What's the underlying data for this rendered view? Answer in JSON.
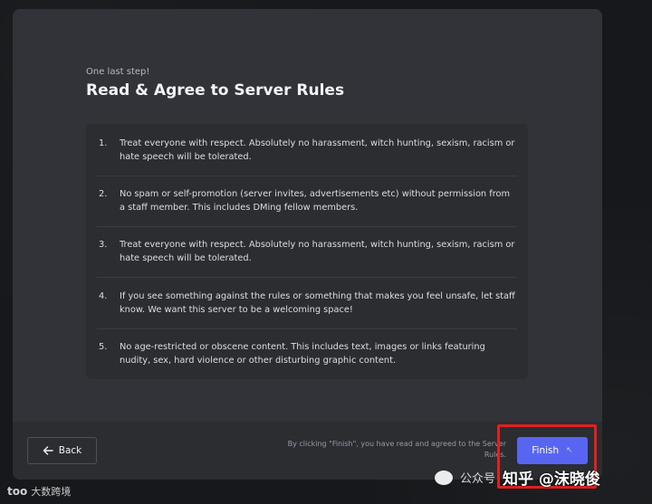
{
  "header": {
    "eyebrow": "One last step!",
    "title": "Read & Agree to Server Rules"
  },
  "rules": [
    {
      "num": "1.",
      "text": "Treat everyone with respect. Absolutely no harassment, witch hunting, sexism, racism or hate speech will be tolerated."
    },
    {
      "num": "2.",
      "text": "No spam or self-promotion (server invites, advertisements etc) without permission from a staff member. This includes DMing fellow members."
    },
    {
      "num": "3.",
      "text": "Treat everyone with respect. Absolutely no harassment, witch hunting, sexism, racism or hate speech will be tolerated."
    },
    {
      "num": "4.",
      "text": "If you see something against the rules or something that makes you feel unsafe, let staff know. We want this server to be a welcoming space!"
    },
    {
      "num": "5.",
      "text": "No age-restricted or obscene content. This includes text, images or links featuring nudity, sex, hard violence or other disturbing graphic content."
    }
  ],
  "footer": {
    "back_label": "Back",
    "agree_text": "By clicking \"Finish\", you have read and agreed to the Server Rules.",
    "finish_label": "Finish",
    "finish_cursor": "↖"
  },
  "watermarks": {
    "left_logo": "too",
    "left_text": "大数跨境",
    "public_account": "公众号",
    "zhihu": "知乎 @沫晓俊"
  },
  "colors": {
    "accent": "#5865f2",
    "highlight_border": "#e02020",
    "modal_bg": "#313338",
    "panel_bg": "#2b2d31"
  }
}
